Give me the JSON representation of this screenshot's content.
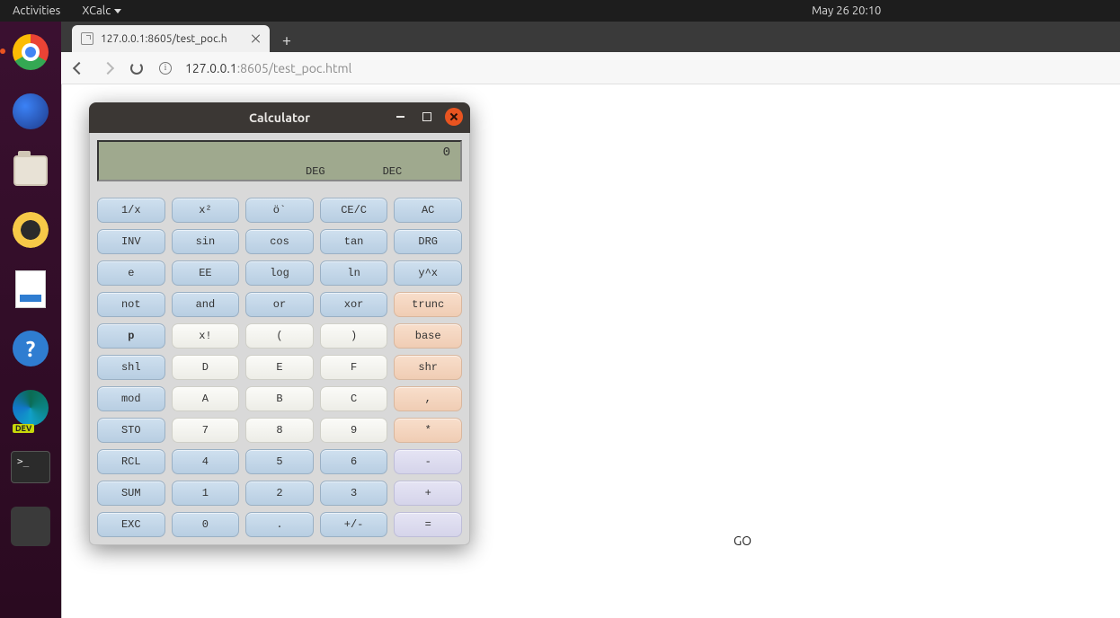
{
  "topbar": {
    "activities": "Activities",
    "app_menu": "XCalc",
    "clock": "May 26  20:10"
  },
  "dock": {
    "items": [
      {
        "name": "chrome",
        "label": "Google Chrome"
      },
      {
        "name": "thunderbird",
        "label": "Thunderbird"
      },
      {
        "name": "files",
        "label": "Files"
      },
      {
        "name": "rhythmbox",
        "label": "Rhythmbox"
      },
      {
        "name": "writer",
        "label": "LibreOffice Writer"
      },
      {
        "name": "help",
        "label": "Help"
      },
      {
        "name": "edge-dev",
        "label": "Microsoft Edge Dev",
        "badge": "DEV"
      },
      {
        "name": "terminal",
        "label": "Terminal"
      },
      {
        "name": "trash",
        "label": "Trash"
      }
    ]
  },
  "browser": {
    "tab_title": "127.0.0.1:8605/test_poc.h",
    "url_host": "127.0.0.1",
    "url_rest": ":8605/test_poc.html"
  },
  "page": {
    "go_label": "GO"
  },
  "calc": {
    "title": "Calculator",
    "display_value": "0",
    "angle_mode": "DEG",
    "base_mode": "DEC",
    "rows": [
      [
        {
          "label": "1/x",
          "style": "blue"
        },
        {
          "label": "x²",
          "style": "blue"
        },
        {
          "label": "ö`",
          "style": "blue"
        },
        {
          "label": "CE/C",
          "style": "blue"
        },
        {
          "label": "AC",
          "style": "blue"
        }
      ],
      [
        {
          "label": "INV",
          "style": "blue"
        },
        {
          "label": "sin",
          "style": "blue"
        },
        {
          "label": "cos",
          "style": "blue"
        },
        {
          "label": "tan",
          "style": "blue"
        },
        {
          "label": "DRG",
          "style": "blue"
        }
      ],
      [
        {
          "label": "e",
          "style": "blue"
        },
        {
          "label": "EE",
          "style": "blue"
        },
        {
          "label": "log",
          "style": "blue"
        },
        {
          "label": "ln",
          "style": "blue"
        },
        {
          "label": "y^x",
          "style": "blue"
        }
      ],
      [
        {
          "label": "not",
          "style": "blue"
        },
        {
          "label": "and",
          "style": "blue"
        },
        {
          "label": "or",
          "style": "blue"
        },
        {
          "label": "xor",
          "style": "blue"
        },
        {
          "label": "trunc",
          "style": "peach"
        }
      ],
      [
        {
          "label": "p",
          "style": "blue",
          "bold": true
        },
        {
          "label": "x!",
          "style": "light"
        },
        {
          "label": "(",
          "style": "light"
        },
        {
          "label": ")",
          "style": "light"
        },
        {
          "label": "base",
          "style": "peach"
        }
      ],
      [
        {
          "label": "shl",
          "style": "blue"
        },
        {
          "label": "D",
          "style": "light"
        },
        {
          "label": "E",
          "style": "light"
        },
        {
          "label": "F",
          "style": "light"
        },
        {
          "label": "shr",
          "style": "peach"
        }
      ],
      [
        {
          "label": "mod",
          "style": "blue"
        },
        {
          "label": "A",
          "style": "light"
        },
        {
          "label": "B",
          "style": "light"
        },
        {
          "label": "C",
          "style": "light"
        },
        {
          "label": ",",
          "style": "peach"
        }
      ],
      [
        {
          "label": "STO",
          "style": "blue"
        },
        {
          "label": "7",
          "style": "light"
        },
        {
          "label": "8",
          "style": "light"
        },
        {
          "label": "9",
          "style": "light"
        },
        {
          "label": "*",
          "style": "peach"
        }
      ],
      [
        {
          "label": "RCL",
          "style": "blue"
        },
        {
          "label": "4",
          "style": "blue"
        },
        {
          "label": "5",
          "style": "blue"
        },
        {
          "label": "6",
          "style": "blue"
        },
        {
          "label": "-",
          "style": "lav"
        }
      ],
      [
        {
          "label": "SUM",
          "style": "blue"
        },
        {
          "label": "1",
          "style": "blue"
        },
        {
          "label": "2",
          "style": "blue"
        },
        {
          "label": "3",
          "style": "blue"
        },
        {
          "label": "+",
          "style": "lav"
        }
      ],
      [
        {
          "label": "EXC",
          "style": "blue"
        },
        {
          "label": "0",
          "style": "blue"
        },
        {
          "label": ".",
          "style": "blue"
        },
        {
          "label": "+/-",
          "style": "blue"
        },
        {
          "label": "=",
          "style": "lav"
        }
      ]
    ]
  }
}
